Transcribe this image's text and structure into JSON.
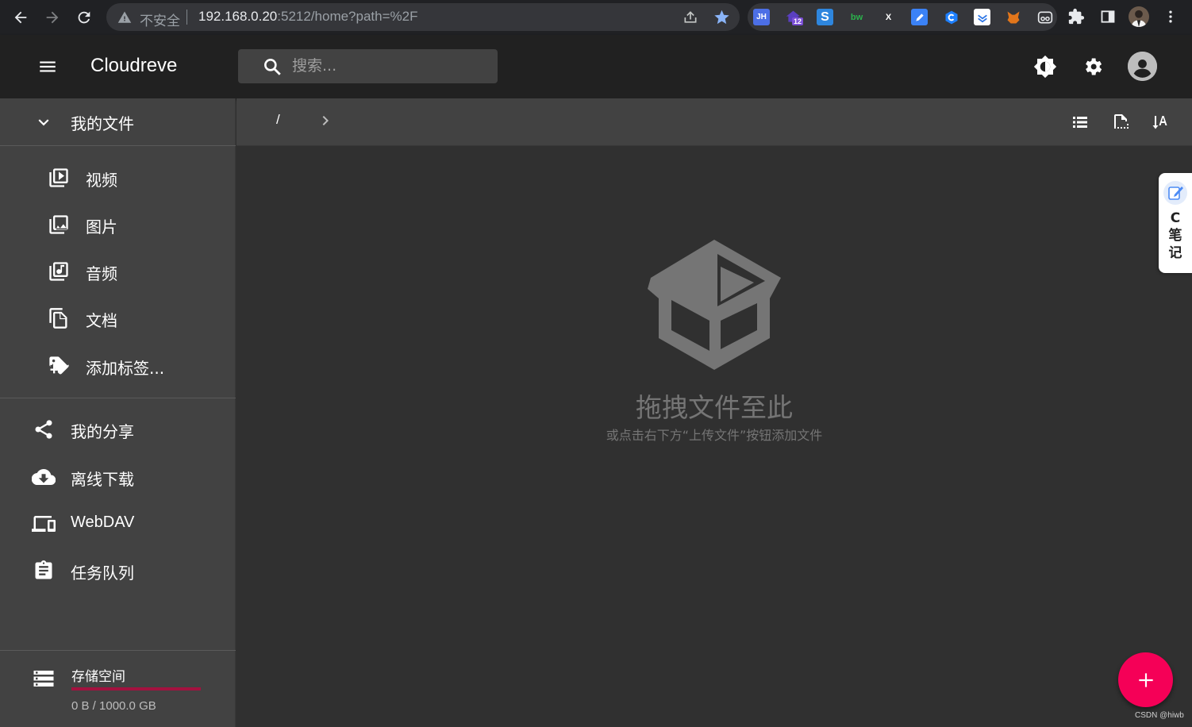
{
  "browser": {
    "security_label": "不安全",
    "url_host": "192.168.0.20",
    "url_rest": ":5212/home?path=%2F",
    "extension_badge": "12",
    "extensions": [
      "JH",
      "S",
      "bw",
      "X"
    ]
  },
  "appbar": {
    "title": "Cloudreve",
    "search_placeholder": "搜索..."
  },
  "sidebar": {
    "my_files": "我的文件",
    "categories": [
      "视频",
      "图片",
      "音频",
      "文档",
      "添加标签..."
    ],
    "items": [
      "我的分享",
      "离线下载",
      "WebDAV",
      "任务队列"
    ],
    "storage": {
      "title": "存储空间",
      "usage": "0 B / 1000.0 GB",
      "used_fraction": 0
    }
  },
  "toolbar": {
    "breadcrumb_root": "/"
  },
  "empty_state": {
    "title": "拖拽文件至此",
    "subtitle": "或点击右下方“上传文件”按钮添加文件"
  },
  "note_widget": {
    "label": "C\n笔\n记"
  },
  "watermark": "CSDN @hiwb",
  "colors": {
    "accent": "#f50057",
    "storage_bar": "#a3123f",
    "appbar": "#212121",
    "sidebar": "#424242",
    "content": "#303030"
  }
}
